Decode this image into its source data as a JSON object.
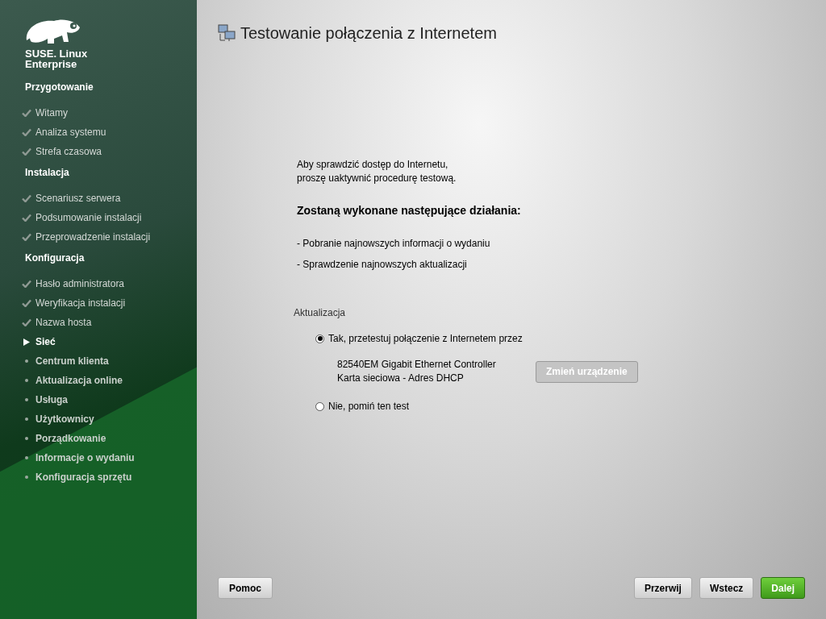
{
  "brand": {
    "line1": "SUSE. Linux",
    "line2": "Enterprise"
  },
  "sidebar": {
    "sections": [
      {
        "title": "Przygotowanie",
        "items": [
          {
            "label": "Witamy",
            "kind": "done"
          },
          {
            "label": "Analiza systemu",
            "kind": "done"
          },
          {
            "label": "Strefa czasowa",
            "kind": "done"
          }
        ]
      },
      {
        "title": "Instalacja",
        "items": [
          {
            "label": "Scenariusz serwera",
            "kind": "done"
          },
          {
            "label": "Podsumowanie instalacji",
            "kind": "done"
          },
          {
            "label": "Przeprowadzenie instalacji",
            "kind": "done"
          }
        ]
      },
      {
        "title": "Konfiguracja",
        "items": [
          {
            "label": "Hasło administratora",
            "kind": "done"
          },
          {
            "label": "Weryfikacja instalacji",
            "kind": "done"
          },
          {
            "label": "Nazwa hosta",
            "kind": "done"
          },
          {
            "label": "Sieć",
            "kind": "current"
          },
          {
            "label": "Centrum klienta",
            "kind": "pending"
          },
          {
            "label": "Aktualizacja online",
            "kind": "pending"
          },
          {
            "label": "Usługa",
            "kind": "pending"
          },
          {
            "label": "Użytkownicy",
            "kind": "pending"
          },
          {
            "label": "Porządkowanie",
            "kind": "pending"
          },
          {
            "label": "Informacje o wydaniu",
            "kind": "pending"
          },
          {
            "label": "Konfiguracja sprzętu",
            "kind": "pending"
          }
        ]
      }
    ]
  },
  "page": {
    "title": "Testowanie połączenia z Internetem",
    "intro": [
      "Aby sprawdzić dostęp do Internetu,",
      "proszę uaktywnić procedurę testową."
    ],
    "actions_heading": "Zostaną wykonane następujące działania:",
    "actions": [
      "- Pobranie najnowszych informacji o wydaniu",
      "- Sprawdzenie najnowszych aktualizacji"
    ],
    "group": {
      "label": "Aktualizacja",
      "options": [
        {
          "label": "Tak, przetestuj połączenie z Internetem przez",
          "selected": true
        },
        {
          "label": "Nie, pomiń ten test",
          "selected": false
        }
      ],
      "device": [
        "82540EM Gigabit Ethernet Controller",
        "Karta sieciowa - Adres DHCP"
      ],
      "change_button": {
        "label": "Zmień urządzenie",
        "disabled": true
      }
    }
  },
  "footer": {
    "help": "Pomoc",
    "buttons": [
      {
        "label": "Przerwij",
        "kind": "normal"
      },
      {
        "label": "Wstecz",
        "kind": "normal"
      },
      {
        "label": "Dalej",
        "kind": "primary"
      }
    ]
  }
}
